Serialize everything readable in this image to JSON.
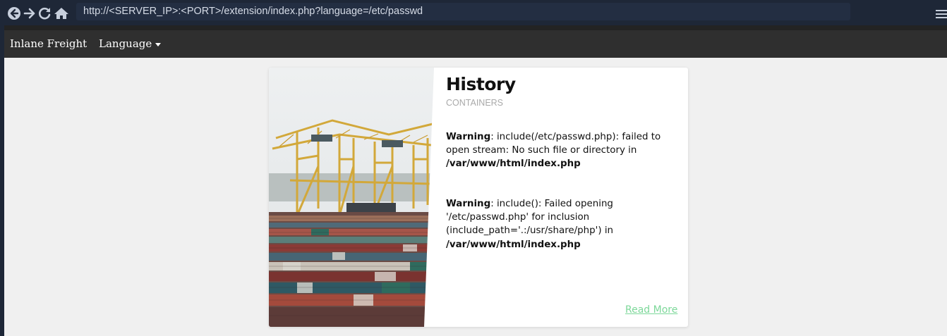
{
  "browser": {
    "url": "http://<SERVER_IP>:<PORT>/extension/index.php?language=/etc/passwd",
    "icons": [
      "back-icon",
      "forward-icon",
      "reload-icon",
      "home-icon",
      "menu-icon"
    ]
  },
  "navbar": {
    "brand": "Inlane Freight",
    "language_label": "Language"
  },
  "card": {
    "title": "History",
    "subtitle": "CONTAINERS",
    "warning1": {
      "label": "Warning",
      "text": ": include(/etc/passwd.php): failed to open stream: No such file or directory in ",
      "path": "/var/www/html/index.php"
    },
    "warning2": {
      "label": "Warning",
      "text": ": include(): Failed opening '/etc/passwd.php' for inclusion (include_path='.:/usr/share/php') in ",
      "path": "/var/www/html/index.php"
    },
    "read_more": "Read More"
  },
  "colors": {
    "browser_bar": "#1e2737",
    "navbar": "#2f2f2f",
    "page_bg": "#f0f0f0",
    "link": "#7dd89a"
  }
}
